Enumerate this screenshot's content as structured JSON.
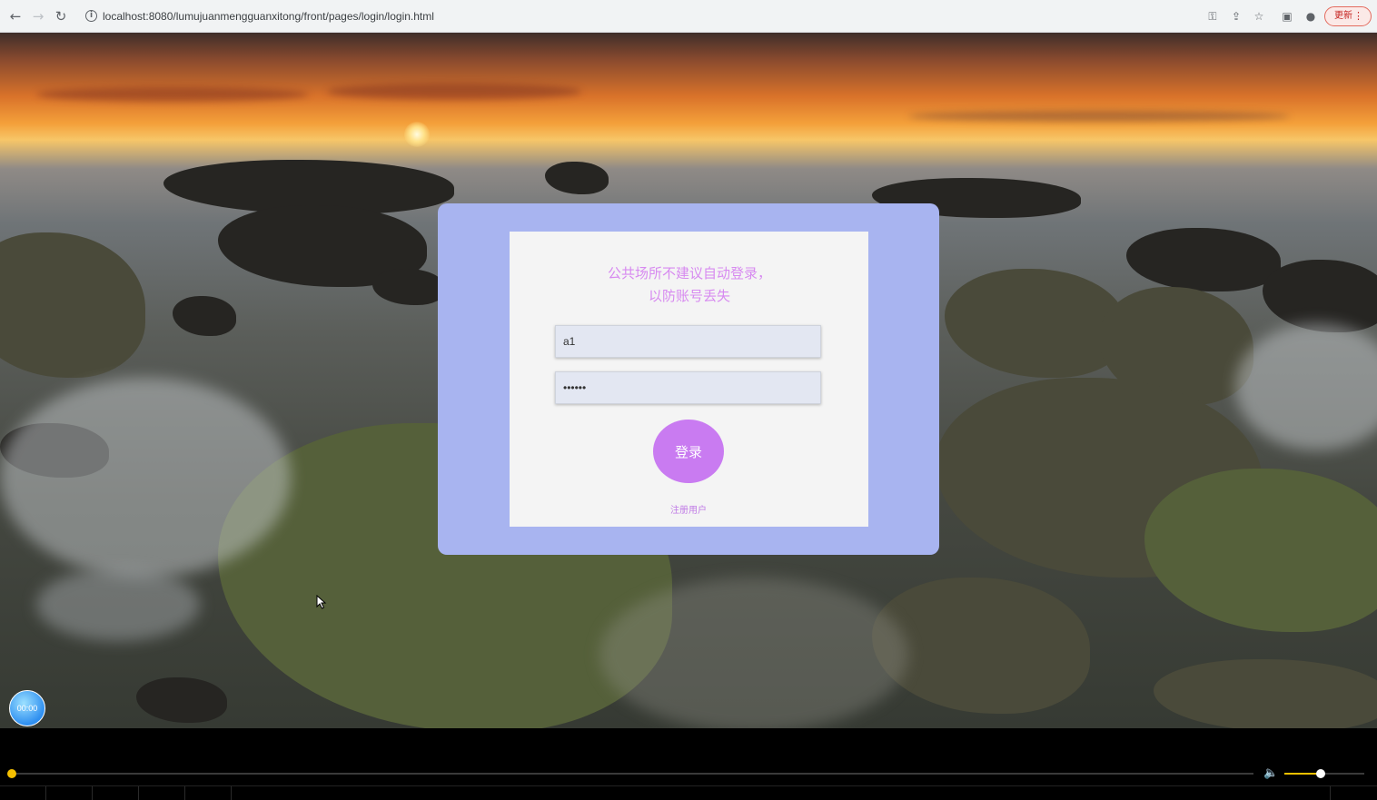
{
  "browser": {
    "url": "localhost:8080/lumujuanmengguanxitong/front/pages/login/login.html",
    "update_label": "更新"
  },
  "login": {
    "tip_text": "公共场所不建议自动登录，以防账号丢失",
    "username_value": "a1",
    "password_value": "123456",
    "login_label": "登录",
    "register_label": "注册用户"
  },
  "badge_label": "00:00",
  "player": {
    "progress": 0.0,
    "volume": 0.45
  },
  "colors": {
    "card_outer": "#a8b4f0",
    "card_inner": "#f4f4f4",
    "accent": "#c97bf1",
    "tip_text": "#d78af0",
    "player_accent": "#f6c000"
  }
}
